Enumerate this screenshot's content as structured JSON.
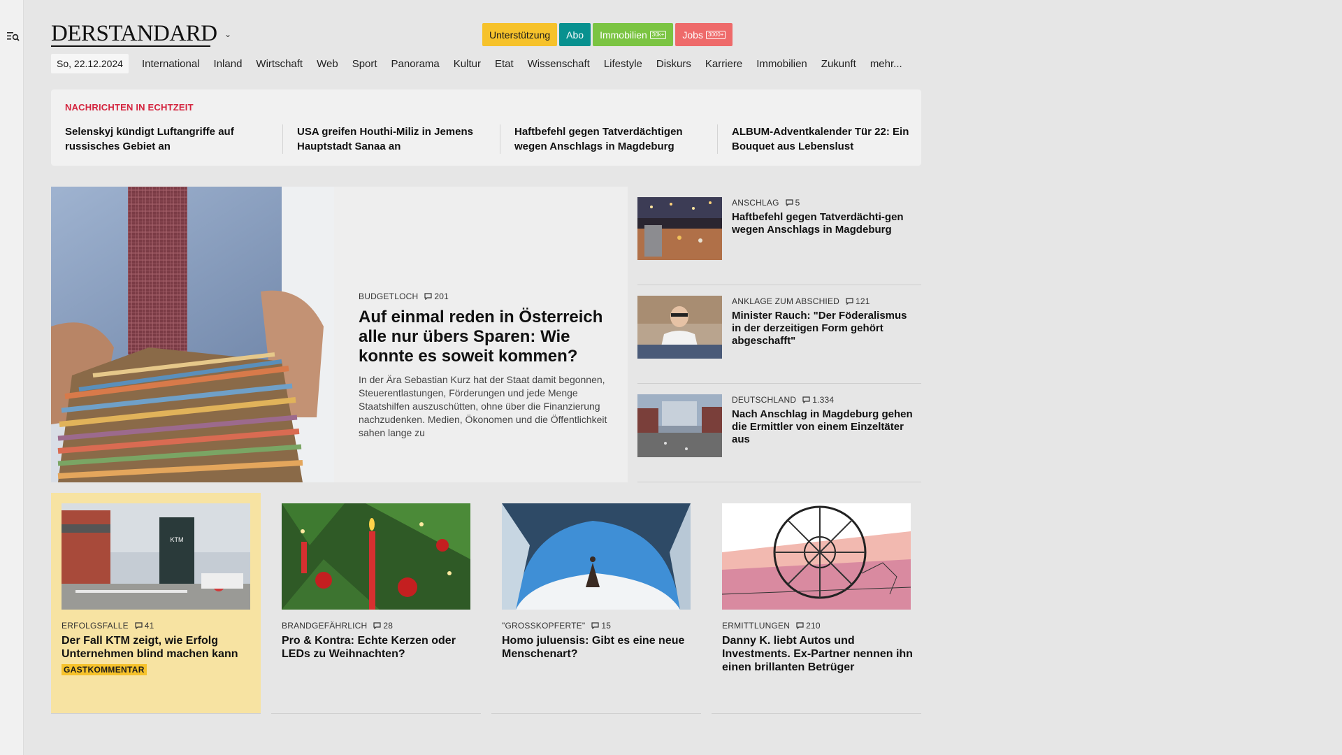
{
  "header": {
    "logo_text": "DERSTANDARD",
    "buttons": [
      {
        "label": "Unterstützung"
      },
      {
        "label": "Abo"
      },
      {
        "label": "Immobilien",
        "pill": "30k+"
      },
      {
        "label": "Jobs",
        "pill": "3000+"
      }
    ]
  },
  "nav": {
    "date": "So, 22.12.2024",
    "items": [
      "International",
      "Inland",
      "Wirtschaft",
      "Web",
      "Sport",
      "Panorama",
      "Kultur",
      "Etat",
      "Wissenschaft",
      "Lifestyle",
      "Diskurs",
      "Karriere",
      "Immobilien",
      "Zukunft",
      "mehr..."
    ]
  },
  "ticker": {
    "title": "NACHRICHTEN IN ECHTZEIT",
    "items": [
      "Selenskyj kündigt Luftangriffe auf russisches Gebiet an",
      "USA greifen Houthi-Miliz in Jemens Hauptstadt Sanaa an",
      "Haftbefehl gegen Tatverdächtigen wegen Anschlags in Magdeburg",
      "ALBUM-Adventkalender Tür 22: Ein Bouquet aus Lebenslust"
    ]
  },
  "hero": {
    "kicker": "BUDGETLOCH",
    "comments": "201",
    "title": "Auf einmal reden in Österreich alle nur übers Sparen: Wie konnte es soweit kommen?",
    "lead": "In der Ära Sebastian Kurz hat der Staat damit begonnen, Steuerentlastungen, Förderungen und jede Menge Staatshilfen auszuschütten, ohne über die Finanzierung nachzudenken. Medien, Ökonomen und die Öffentlichkeit sahen lange zu"
  },
  "side": [
    {
      "kicker": "ANSCHLAG",
      "comments": "5",
      "title": "Haftbefehl gegen Tatverdächti-gen wegen Anschlags in Magdeburg"
    },
    {
      "kicker": "ANKLAGE ZUM ABSCHIED",
      "comments": "121",
      "title": "Minister Rauch: \"Der Föderalismus in der derzeitigen Form gehört abgeschafft\""
    },
    {
      "kicker": "DEUTSCHLAND",
      "comments": "1.334",
      "title": "Nach Anschlag in Magdeburg gehen die Ermittler von einem Einzeltäter aus"
    }
  ],
  "cards": [
    {
      "kicker": "ERFOLGSFALLE",
      "comments": "41",
      "title": "Der Fall KTM zeigt, wie Erfolg Unternehmen blind machen kann",
      "badge": "GASTKOMMENTAR",
      "image_text": "KTM"
    },
    {
      "kicker": "BRANDGEFÄHRLICH",
      "comments": "28",
      "title": "Pro & Kontra: Echte Kerzen oder LEDs zu Weihnachten?"
    },
    {
      "kicker": "\"GROSSKOPFERTE\"",
      "comments": "15",
      "title": "Homo juluensis: Gibt es eine neue Menschenart?"
    },
    {
      "kicker": "ERMITTLUNGEN",
      "comments": "210",
      "title": "Danny K. liebt Autos und Investments. Ex-Partner nennen ihn einen brillanten Betrüger"
    }
  ],
  "colors": {
    "accent_red": "#d4243e",
    "support_yellow": "#f6c22b",
    "abo_teal": "#08918f",
    "immo_green": "#7bc442",
    "jobs_red": "#ee6a6a"
  }
}
